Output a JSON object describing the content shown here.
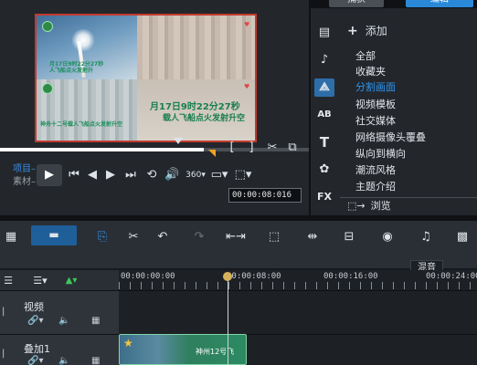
{
  "library": {
    "tab_capture": "捕获",
    "tab_edit": "编辑",
    "add_label": "添加",
    "items": [
      "全部",
      "收藏夹",
      "分割画面",
      "视频模板",
      "社交媒体",
      "网络摄像头覆叠",
      "纵向到横向",
      "潮流风格",
      "主题介绍"
    ],
    "selected_item": "分割画面",
    "browse_label": "浏览",
    "toolbar_icons": [
      "media-icon",
      "audio-icon",
      "transition-icon",
      "title-icon",
      "text-icon",
      "graphics-icon",
      "fx-icon"
    ],
    "title_icon_text": "AB",
    "text_icon_text": "T",
    "fx_icon_text": "FX"
  },
  "preview": {
    "caption_small": "月17日9时22分27秒\n人飞船点火发射升",
    "caption_small_2": "神舟十二号载人飞船点火发射升空",
    "caption_large_1": "月17日9时22分27秒",
    "caption_large_2": "载人飞船点火发射升空",
    "mode_project": "项目",
    "mode_clip": "素材",
    "timecode": "00:00:08:016",
    "in_mark": "[",
    "out_mark": "]",
    "scrub_progress": 0.66
  },
  "timeline": {
    "ruler_labels": [
      "00:00:00:00",
      "00:00:08:00",
      "00:00:16:00",
      "00:00:24:00"
    ],
    "tracks": [
      {
        "name": "视频"
      },
      {
        "name": "叠加1"
      }
    ],
    "tooltip": "混音",
    "clip_label": "神州12号飞"
  },
  "colors": {
    "accent": "#2a88d8",
    "selection_border": "#c23a2e",
    "selected_text": "#2f95f0"
  }
}
